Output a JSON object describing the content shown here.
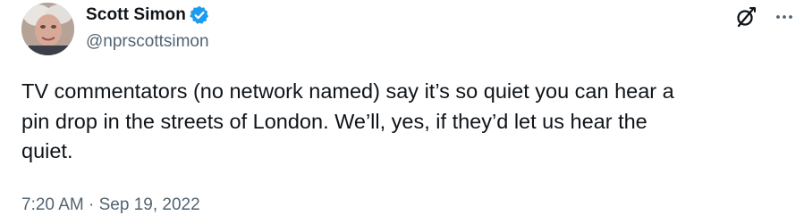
{
  "author": {
    "display_name": "Scott Simon",
    "handle": "@nprscottsimon",
    "verified": true
  },
  "icons": {
    "verified": "verified-badge-icon",
    "grok": "grok-icon",
    "more": "more-options-icon"
  },
  "colors": {
    "text": "#0f1419",
    "secondary": "#536471",
    "verified": "#1d9bf0"
  },
  "tweet": {
    "text": "TV commentators (no network named) say it’s so quiet you can hear a\npin drop in the streets of London. We’ll, yes, if they’d let us hear the\nquiet.",
    "time": "7:20 AM",
    "separator": " · ",
    "date": "Sep 19, 2022"
  }
}
